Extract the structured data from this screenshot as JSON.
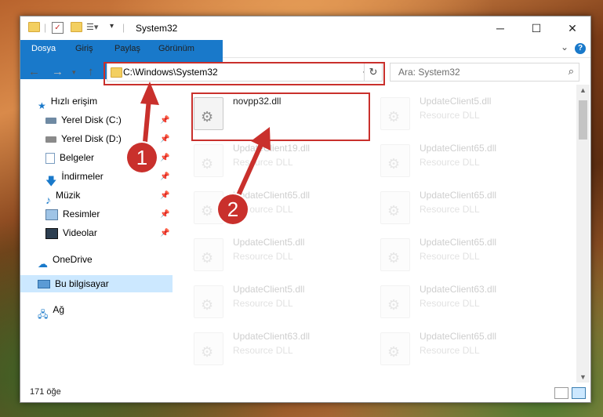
{
  "window": {
    "title": "System32",
    "controls": {
      "minimize": "─",
      "maximize": "☐",
      "close": "✕"
    }
  },
  "ribbon": {
    "tabs": [
      "Dosya",
      "Giriş",
      "Paylaş",
      "Görünüm"
    ],
    "help": "?"
  },
  "navbar": {
    "address": "C:\\Windows\\System32",
    "search_placeholder": "Ara: System32"
  },
  "sidebar": {
    "quick_access": "Hızlı erişim",
    "items": [
      {
        "label": "Yerel Disk (C:)",
        "icon": "drive-icon"
      },
      {
        "label": "Yerel Disk (D:)",
        "icon": "drive-icon"
      },
      {
        "label": "Belgeler",
        "icon": "documents-icon"
      },
      {
        "label": "İndirmeler",
        "icon": "downloads-icon"
      },
      {
        "label": "Müzik",
        "icon": "music-icon"
      },
      {
        "label": "Resimler",
        "icon": "pictures-icon"
      },
      {
        "label": "Videolar",
        "icon": "videos-icon"
      }
    ],
    "onedrive": "OneDrive",
    "this_pc": "Bu bilgisayar",
    "network": "Ağ"
  },
  "files": {
    "highlighted": {
      "name": "novpp32.dll"
    },
    "left_column": [
      {
        "name": "UpdateClient19.dll",
        "desc": "Resource DLL"
      },
      {
        "name": "UpdateClient65.dll",
        "desc": "Resource DLL"
      },
      {
        "name": "UpdateClient5.dll",
        "desc": "Resource DLL"
      },
      {
        "name": "UpdateClient5.dll",
        "desc": "Resource DLL"
      },
      {
        "name": "UpdateClient63.dll",
        "desc": "Resource DLL"
      }
    ],
    "right_column": [
      {
        "name": "UpdateClient5.dll",
        "desc": "Resource DLL"
      },
      {
        "name": "UpdateClient65.dll",
        "desc": "Resource DLL"
      },
      {
        "name": "UpdateClient65.dll",
        "desc": "Resource DLL"
      },
      {
        "name": "UpdateClient65.dll",
        "desc": "Resource DLL"
      },
      {
        "name": "UpdateClient63.dll",
        "desc": "Resource DLL"
      },
      {
        "name": "UpdateClient65.dll",
        "desc": "Resource DLL"
      }
    ]
  },
  "status": {
    "count": "171 öğe"
  },
  "annotations": {
    "step1": "1",
    "step2": "2",
    "color": "#c9302c"
  }
}
